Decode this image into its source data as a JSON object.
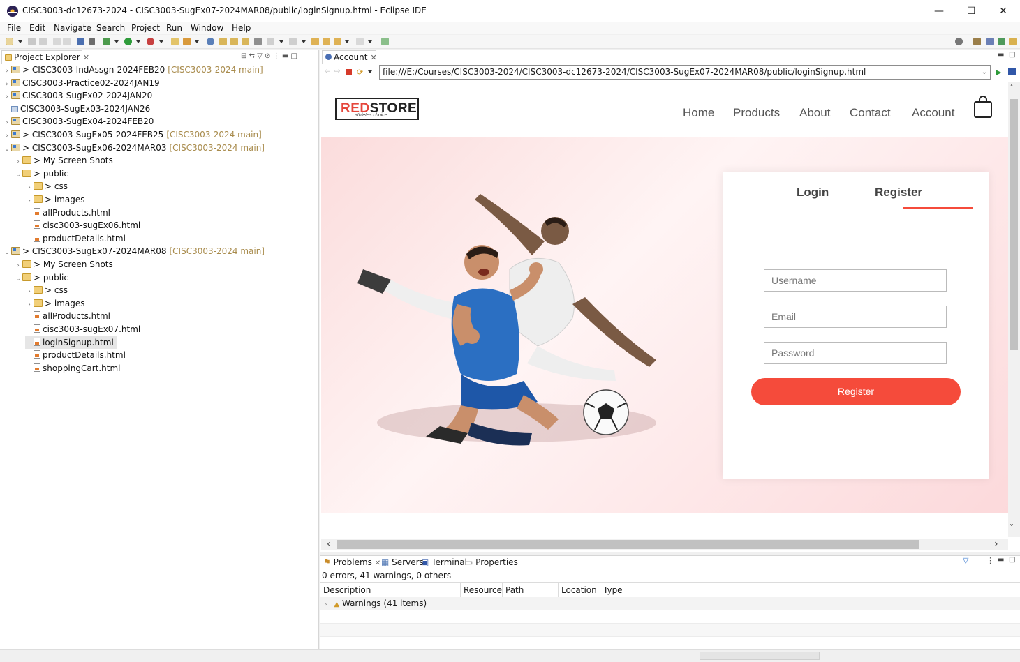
{
  "window": {
    "title": "CISC3003-dc12673-2024 - CISC3003-SugEx07-2024MAR08/public/loginSignup.html - Eclipse IDE",
    "minimize": "—",
    "maximize": "☐",
    "close": "✕"
  },
  "menu": [
    "File",
    "Edit",
    "Navigate",
    "Search",
    "Project",
    "Run",
    "Window",
    "Help"
  ],
  "explorer": {
    "tab_label": "Project Explorer",
    "items": [
      {
        "chev": "›",
        "indent": 0,
        "icon": "proj",
        "prefix": "> ",
        "label": "CISC3003-IndAssgn-2024FEB20",
        "repo": "[CISC3003-2024 main]"
      },
      {
        "chev": "›",
        "indent": 0,
        "icon": "proj",
        "prefix": "",
        "label": "CISC3003-Practice02-2024JAN19",
        "repo": ""
      },
      {
        "chev": "›",
        "indent": 0,
        "icon": "proj",
        "prefix": "",
        "label": "CISC3003-SugEx02-2024JAN20",
        "repo": ""
      },
      {
        "chev": "",
        "indent": 0,
        "icon": "closed",
        "prefix": "",
        "label": "CISC3003-SugEx03-2024JAN26",
        "repo": ""
      },
      {
        "chev": "›",
        "indent": 0,
        "icon": "proj",
        "prefix": "",
        "label": "CISC3003-SugEx04-2024FEB20",
        "repo": ""
      },
      {
        "chev": "›",
        "indent": 0,
        "icon": "proj",
        "prefix": "> ",
        "label": "CISC3003-SugEx05-2024FEB25",
        "repo": "[CISC3003-2024 main]"
      },
      {
        "chev": "⌄",
        "indent": 0,
        "icon": "proj",
        "prefix": "> ",
        "label": "CISC3003-SugEx06-2024MAR03",
        "repo": "[CISC3003-2024 main]"
      },
      {
        "chev": "›",
        "indent": 1,
        "icon": "folder",
        "prefix": "> ",
        "label": "My Screen Shots",
        "repo": ""
      },
      {
        "chev": "⌄",
        "indent": 1,
        "icon": "folder",
        "prefix": "> ",
        "label": "public",
        "repo": ""
      },
      {
        "chev": "›",
        "indent": 2,
        "icon": "folder",
        "prefix": "> ",
        "label": "css",
        "repo": ""
      },
      {
        "chev": "›",
        "indent": 2,
        "icon": "folder",
        "prefix": "> ",
        "label": "images",
        "repo": ""
      },
      {
        "chev": "",
        "indent": 2,
        "icon": "html",
        "prefix": "",
        "label": "allProducts.html",
        "repo": ""
      },
      {
        "chev": "",
        "indent": 2,
        "icon": "html",
        "prefix": "",
        "label": "cisc3003-sugEx06.html",
        "repo": ""
      },
      {
        "chev": "",
        "indent": 2,
        "icon": "html",
        "prefix": "",
        "label": "productDetails.html",
        "repo": ""
      },
      {
        "chev": "⌄",
        "indent": 0,
        "icon": "proj",
        "prefix": "> ",
        "label": "CISC3003-SugEx07-2024MAR08",
        "repo": "[CISC3003-2024 main]"
      },
      {
        "chev": "›",
        "indent": 1,
        "icon": "folder",
        "prefix": "> ",
        "label": "My Screen Shots",
        "repo": ""
      },
      {
        "chev": "⌄",
        "indent": 1,
        "icon": "folder",
        "prefix": "> ",
        "label": "public",
        "repo": ""
      },
      {
        "chev": "›",
        "indent": 2,
        "icon": "folder",
        "prefix": "> ",
        "label": "css",
        "repo": ""
      },
      {
        "chev": "›",
        "indent": 2,
        "icon": "folder",
        "prefix": "> ",
        "label": "images",
        "repo": ""
      },
      {
        "chev": "",
        "indent": 2,
        "icon": "html",
        "prefix": "",
        "label": "allProducts.html",
        "repo": ""
      },
      {
        "chev": "",
        "indent": 2,
        "icon": "html",
        "prefix": "",
        "label": "cisc3003-sugEx07.html",
        "repo": ""
      },
      {
        "chev": "",
        "indent": 2,
        "icon": "html",
        "prefix": "",
        "label": "loginSignup.html",
        "repo": "",
        "selected": true
      },
      {
        "chev": "",
        "indent": 2,
        "icon": "html",
        "prefix": "",
        "label": "productDetails.html",
        "repo": ""
      },
      {
        "chev": "",
        "indent": 2,
        "icon": "html",
        "prefix": "",
        "label": "shoppingCart.html",
        "repo": ""
      }
    ]
  },
  "editor": {
    "tab_label": "Account",
    "url": "file:///E:/Courses/CISC3003-2024/CISC3003-dc12673-2024/CISC3003-SugEx07-2024MAR08/public/loginSignup.html"
  },
  "site": {
    "logo_text_a": "RED",
    "logo_text_b": "STORE",
    "logo_tagline": "athletes choice",
    "nav": [
      "Home",
      "Products",
      "About",
      "Contact",
      "Account"
    ],
    "accent": "#f54b3b",
    "form": {
      "tab_login": "Login",
      "tab_register": "Register",
      "username_placeholder": "Username",
      "email_placeholder": "Email",
      "password_placeholder": "Password",
      "submit": "Register"
    }
  },
  "bottom": {
    "tabs": [
      "Problems",
      "Servers",
      "Terminal",
      "Properties"
    ],
    "summary": "0 errors, 41 warnings, 0 others",
    "columns": [
      "Description",
      "Resource",
      "Path",
      "Location",
      "Type"
    ],
    "rows": [
      {
        "description": "Warnings (41 items)"
      }
    ]
  }
}
